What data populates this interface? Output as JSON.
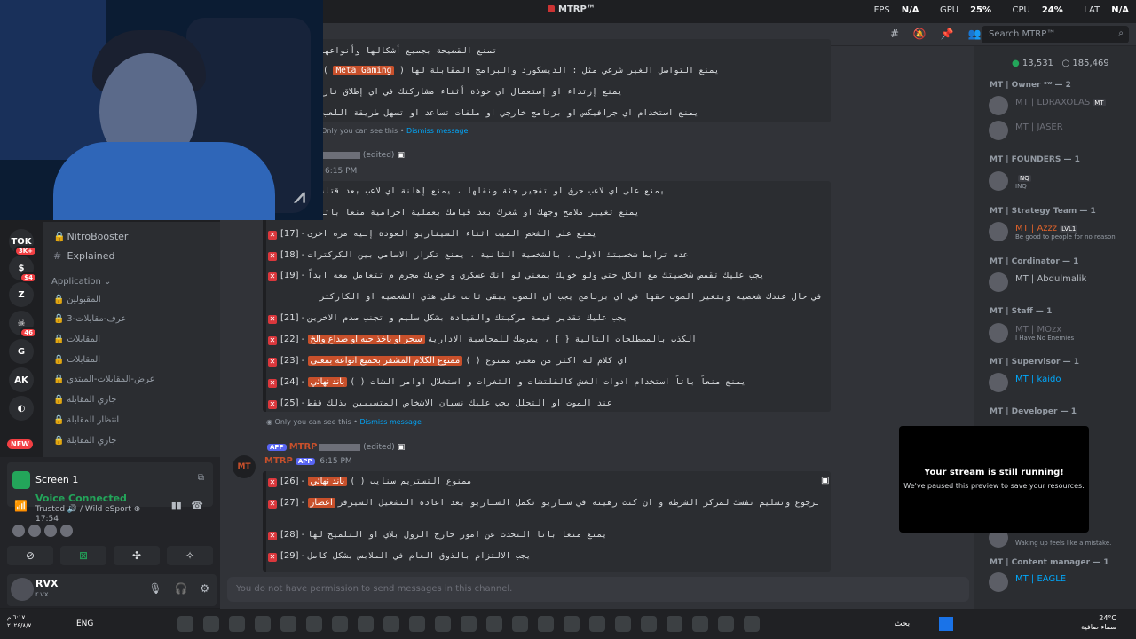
{
  "titlebar": {
    "app_title": "MTRP™",
    "fps_label": "FPS",
    "fps_value": "N/A",
    "gpu_label": "GPU",
    "gpu_value": "25%",
    "cpu_label": "CPU",
    "cpu_value": "24%",
    "lat_label": "LAT",
    "lat_value": "N/A"
  },
  "toolbar": {
    "search_placeholder": "Search MTRP™"
  },
  "servers": [
    {
      "label": "TOK",
      "badge": "3K+"
    },
    {
      "label": "$",
      "badge": "$4"
    },
    {
      "label": "Z",
      "badge": ""
    },
    {
      "label": "☠",
      "badge": "46"
    },
    {
      "label": "G",
      "badge": ""
    },
    {
      "label": "AK",
      "badge": ""
    },
    {
      "label": "◐",
      "badge": ""
    }
  ],
  "new_pill": "NEW",
  "channels": {
    "nitro": "NitroBooster",
    "explained": "Explained",
    "category": "Application",
    "items": [
      "المقبولين",
      "3-عرف-مقابلات",
      "المقابلات",
      "المقابلات",
      "عرض-المقابلات-المبتدي",
      "جاري المقابلة",
      "انتظار المقابلة",
      "جاري المقابلة"
    ]
  },
  "user_panel": {
    "screen_title": "Screen 1",
    "voice_status": "Voice Connected",
    "voice_sub": "Trusted 🔊 / Wild eSport ⊕",
    "voice_time": "17:54",
    "username": "RVX",
    "user_status": "r.vx"
  },
  "chat": {
    "top_rules": [
      "تمنع القضيحة بجميع أشكالها وأنواعها",
      "يمنع التواصل الغير شرعي مثل : الديسكورد والبرامج المقابلة لها",
      "يمنع إرتداء او إستعمال اي خوذة أثناء مشاركتك في اي إطلاق نار",
      "يمنع استخدام اي جرافيكس او برنامج خارجي او ملفات تساعد او تسهل طريقة اللعب"
    ],
    "meta_gaming": "Meta Gaming",
    "only_you_1": "Only you can see this •",
    "dismiss": "Dismiss message",
    "edited": "(edited)",
    "time_1": "6:15 PM",
    "rules_mid": [
      {
        "num": "",
        "text": "يمنع على اي لاعب حرق او تفجير جثة ونقلها ، يمنع إهانة اي لاعب بعد قتله"
      },
      {
        "num": "",
        "text": "يمنع تغيير ملامح وجهك او شعرك بعد قيامك بعملية اجرامية منعا باتا"
      },
      {
        "num": "[17] -",
        "text": "يمنع على الشخص الميت اثناء السيناريو العودة إليه مره اخرى"
      },
      {
        "num": "[18] -",
        "text": "عدم ترابط شخصيتك الاولى ، بالشخصية الثانية ، يمنع تكرار الاسامي بين الكركترات"
      },
      {
        "num": "[19] -",
        "text": "يجب عليك تقمص شخصيتك مع الكل حتى ولو خويك بمعنى لو انك عسكري و خويك مجرم م تتعامل معه ابداً"
      },
      {
        "num": "",
        "text": "في حال عندك شخصيه وبتغير الصوت حقها في اي برنامج يجب ان الصوت يبقى ثابت على هذي الشخصيه او الكاركتر"
      },
      {
        "num": "[21] -",
        "text": "يجب عليك تقدير قيمة مركبتك والقيادة بشكل سليم و تجنب صدم الاخرين"
      },
      {
        "num": "[22] -",
        "text": "الكذب بالمصطلحات التالية { } ، يعرضك للمحاسبة الادارية",
        "hl": "سحر او باخذ حبه او صداع والخ"
      },
      {
        "num": "[23] -",
        "text": "اي كلام له اكثر من معنى ممنوع ( )",
        "hl": "ممنوع الكلام المشفر بجميع انواعه بمعنى"
      },
      {
        "num": "[24] -",
        "text": "يمنع منعاً باتاً استخدام ادوات الغش كالقلتشات و الثغرات و استغلال اوامر الشات ( )",
        "hl": "باند نهائي"
      },
      {
        "num": "[25] -",
        "text": "عند الموت او التحلل يجب عليك نسيان الاشخاص المتسببين بذلك فقط"
      }
    ],
    "only_you_2": "Only you can see this •",
    "app_tag": "APP",
    "bot_name": "MTRP",
    "time_2": "6:15 PM",
    "avatar_text": "MT",
    "rules_low": [
      {
        "num": "[26] -",
        "text": "ممنوع التستريم سنايب ( )",
        "hl": "باند نهائي"
      },
      {
        "num": "[27] -",
        "text": "عند حدوث اعادة تشغيل للسيرفر { } وكنت تحت رهن الاعتقال يجب عليك الرجوع وتسليم نفسك لمركز الشرطة و ان كنت رهينه في سناريو تكمل السناريو بعد اعادة التشغيل السيرفر",
        "hl": "اعصار"
      },
      {
        "num": "[28] -",
        "text": "يمنع منعا باتا التحدث عن امور خارج الرول بلاي او التلميح لها"
      },
      {
        "num": "[29] -",
        "text": "يجب الالتزام بالذوق العام في الملابس بشكل كامل"
      }
    ],
    "composer_placeholder": "You do not have permission to send messages in this channel."
  },
  "members": {
    "online": "13,531",
    "total": "185,469",
    "roles": [
      {
        "title": "MT | Owner ᵒʷ — 2"
      },
      {
        "title": "MT | FOUNDERS — 1"
      },
      {
        "title": "MT | Strategy Team — 1"
      },
      {
        "title": "MT | Cordinator — 1"
      },
      {
        "title": "MT | Staff — 1"
      },
      {
        "title": "MT | Supervisor — 1"
      },
      {
        "title": "MT | Developer — 1"
      },
      {
        "title": "MT | Content manager — 1"
      }
    ],
    "list": [
      {
        "name": "MT | LDRAXOLAS",
        "sub": "",
        "tag": "MT",
        "style": "dim"
      },
      {
        "name": "MT | JASER",
        "sub": "",
        "tag": "",
        "style": "dim"
      },
      {
        "name": "",
        "sub": "INQ",
        "tag": "NQ",
        "style": "dim"
      },
      {
        "name": "MT | Azzz",
        "sub": "Be good to people for no reason",
        "tag": "LVL1",
        "style": "red"
      },
      {
        "name": "MT | Abdulmalik",
        "sub": "",
        "tag": "",
        "style": ""
      },
      {
        "name": "MT | MOzx",
        "sub": "I Have No Enemies",
        "tag": "",
        "style": "dim"
      },
      {
        "name": "MT | kaido",
        "sub": "",
        "tag": "",
        "style": "blue"
      },
      {
        "name": "",
        "sub": "Waking up feels like a mistake.",
        "tag": "",
        "style": "dim"
      },
      {
        "name": "MT | EAGLE",
        "sub": "",
        "tag": "",
        "style": "blue"
      }
    ]
  },
  "stream_popup": {
    "title": "Your stream is still running!",
    "subtitle": "We've paused this preview to save your resources."
  },
  "taskbar": {
    "lang": "ENG",
    "search": "بحث",
    "time_left": "٦:١٧ م",
    "date_left": "٢٠٢٤/٨/٧",
    "temp": "24°C",
    "weather": "سماء صافية"
  }
}
